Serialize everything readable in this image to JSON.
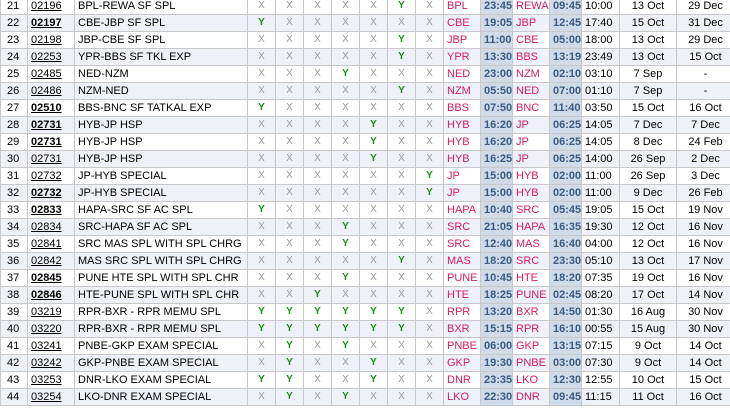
{
  "days_header": [
    "M",
    "T",
    "W",
    "T",
    "F",
    "S",
    "S"
  ],
  "rows": [
    {
      "sn": "21",
      "no": "02196",
      "bold": false,
      "name": "BPL-REWA SF SPL",
      "days": [
        "X",
        "X",
        "X",
        "X",
        "X",
        "Y",
        "X"
      ],
      "from": "BPL",
      "dep": "23:45",
      "to": "REWA",
      "arr": "09:45",
      "dur": "10:00",
      "start": "13 Oct",
      "end": "29 Dec"
    },
    {
      "sn": "22",
      "no": "02197",
      "bold": true,
      "name": "CBE-JBP SF SPL",
      "days": [
        "Y",
        "X",
        "X",
        "X",
        "X",
        "X",
        "X"
      ],
      "from": "CBE",
      "dep": "19:05",
      "to": "JBP",
      "arr": "12:45",
      "dur": "17:40",
      "start": "15 Oct",
      "end": "31 Dec"
    },
    {
      "sn": "23",
      "no": "02198",
      "bold": false,
      "name": "JBP-CBE SF SPL",
      "days": [
        "X",
        "X",
        "X",
        "X",
        "X",
        "Y",
        "X"
      ],
      "from": "JBP",
      "dep": "11:00",
      "to": "CBE",
      "arr": "05:00",
      "dur": "18:00",
      "start": "13 Oct",
      "end": "29 Dec"
    },
    {
      "sn": "24",
      "no": "02253",
      "bold": false,
      "name": "YPR-BBS SF TKL EXP",
      "days": [
        "X",
        "X",
        "X",
        "X",
        "X",
        "Y",
        "X"
      ],
      "from": "YPR",
      "dep": "13:30",
      "to": "BBS",
      "arr": "13:19",
      "dur": "23:49",
      "start": "13 Oct",
      "end": "15 Oct"
    },
    {
      "sn": "25",
      "no": "02485",
      "bold": false,
      "name": "NED-NZM",
      "days": [
        "X",
        "X",
        "X",
        "Y",
        "X",
        "X",
        "X"
      ],
      "from": "NED",
      "dep": "23:00",
      "to": "NZM",
      "arr": "02:10",
      "dur": "03:10",
      "start": "7 Sep",
      "end": "-"
    },
    {
      "sn": "26",
      "no": "02486",
      "bold": false,
      "name": "NZM-NED",
      "days": [
        "X",
        "X",
        "X",
        "X",
        "X",
        "Y",
        "X"
      ],
      "from": "NZM",
      "dep": "05:50",
      "to": "NED",
      "arr": "07:00",
      "dur": "01:10",
      "start": "7 Sep",
      "end": "-"
    },
    {
      "sn": "27",
      "no": "02510",
      "bold": true,
      "name": "BBS-BNC SF TATKAL EXP",
      "days": [
        "Y",
        "X",
        "X",
        "X",
        "X",
        "X",
        "X"
      ],
      "from": "BBS",
      "dep": "07:50",
      "to": "BNC",
      "arr": "11:40",
      "dur": "03:50",
      "start": "15 Oct",
      "end": "16 Oct"
    },
    {
      "sn": "28",
      "no": "02731",
      "bold": true,
      "name": "HYB-JP HSP",
      "days": [
        "X",
        "X",
        "X",
        "X",
        "Y",
        "X",
        "X"
      ],
      "from": "HYB",
      "dep": "16:20",
      "to": "JP",
      "arr": "06:25",
      "dur": "14:05",
      "start": "7 Dec",
      "end": "7 Dec"
    },
    {
      "sn": "29",
      "no": "02731",
      "bold": true,
      "name": "HYB-JP HSP",
      "days": [
        "X",
        "X",
        "X",
        "X",
        "Y",
        "X",
        "X"
      ],
      "from": "HYB",
      "dep": "16:20",
      "to": "JP",
      "arr": "06:25",
      "dur": "14:05",
      "start": "8 Dec",
      "end": "24 Feb"
    },
    {
      "sn": "30",
      "no": "02731",
      "bold": false,
      "name": "HYB-JP HSP",
      "days": [
        "X",
        "X",
        "X",
        "X",
        "Y",
        "X",
        "X"
      ],
      "from": "HYB",
      "dep": "16:25",
      "to": "JP",
      "arr": "06:25",
      "dur": "14:00",
      "start": "26 Sep",
      "end": "2 Dec"
    },
    {
      "sn": "31",
      "no": "02732",
      "bold": false,
      "name": "JP-HYB SPECIAL",
      "days": [
        "X",
        "X",
        "X",
        "X",
        "X",
        "X",
        "Y"
      ],
      "from": "JP",
      "dep": "15:00",
      "to": "HYB",
      "arr": "02:00",
      "dur": "11:00",
      "start": "26 Sep",
      "end": "3 Dec"
    },
    {
      "sn": "32",
      "no": "02732",
      "bold": true,
      "name": "JP-HYB SPECIAL",
      "days": [
        "X",
        "X",
        "X",
        "X",
        "X",
        "X",
        "Y"
      ],
      "from": "JP",
      "dep": "15:00",
      "to": "HYB",
      "arr": "02:00",
      "dur": "11:00",
      "start": "9 Dec",
      "end": "26 Feb"
    },
    {
      "sn": "33",
      "no": "02833",
      "bold": true,
      "name": "HAPA-SRC SF AC SPL",
      "days": [
        "Y",
        "X",
        "X",
        "X",
        "X",
        "X",
        "X"
      ],
      "from": "HAPA",
      "dep": "10:40",
      "to": "SRC",
      "arr": "05:45",
      "dur": "19:05",
      "start": "15 Oct",
      "end": "19 Nov"
    },
    {
      "sn": "34",
      "no": "02834",
      "bold": false,
      "name": "SRC-HAPA SF AC SPL",
      "days": [
        "X",
        "X",
        "X",
        "Y",
        "X",
        "X",
        "X"
      ],
      "from": "SRC",
      "dep": "21:05",
      "to": "HAPA",
      "arr": "16:35",
      "dur": "19:30",
      "start": "12 Oct",
      "end": "16 Nov"
    },
    {
      "sn": "35",
      "no": "02841",
      "bold": false,
      "name": "SRC MAS SPL WITH SPL CHRG",
      "days": [
        "X",
        "X",
        "X",
        "Y",
        "X",
        "X",
        "X"
      ],
      "from": "SRC",
      "dep": "12:40",
      "to": "MAS",
      "arr": "16:40",
      "dur": "04:00",
      "start": "12 Oct",
      "end": "16 Nov"
    },
    {
      "sn": "36",
      "no": "02842",
      "bold": false,
      "name": "MAS SRC SPL WITH SPL CHRG",
      "days": [
        "X",
        "X",
        "X",
        "X",
        "X",
        "Y",
        "X"
      ],
      "from": "MAS",
      "dep": "18:20",
      "to": "SRC",
      "arr": "23:30",
      "dur": "05:10",
      "start": "13 Oct",
      "end": "17 Nov"
    },
    {
      "sn": "37",
      "no": "02845",
      "bold": true,
      "name": "PUNE HTE SPL WITH SPL CHR",
      "days": [
        "X",
        "X",
        "X",
        "Y",
        "X",
        "X",
        "X"
      ],
      "from": "PUNE",
      "dep": "10:45",
      "to": "HTE",
      "arr": "18:20",
      "dur": "07:35",
      "start": "19 Oct",
      "end": "16 Nov"
    },
    {
      "sn": "38",
      "no": "02846",
      "bold": true,
      "name": "HTE-PUNE SPL WITH SPL CHR",
      "days": [
        "X",
        "X",
        "Y",
        "X",
        "X",
        "X",
        "X"
      ],
      "from": "HTE",
      "dep": "18:25",
      "to": "PUNE",
      "arr": "02:45",
      "dur": "08:20",
      "start": "17 Oct",
      "end": "14 Nov"
    },
    {
      "sn": "39",
      "no": "03219",
      "bold": false,
      "name": "RPR-BXR - RPR MEMU SPL",
      "days": [
        "Y",
        "Y",
        "Y",
        "Y",
        "Y",
        "Y",
        "X"
      ],
      "from": "RPR",
      "dep": "13:20",
      "to": "BXR",
      "arr": "14:50",
      "dur": "01:30",
      "start": "16 Aug",
      "end": "30 Nov"
    },
    {
      "sn": "40",
      "no": "03220",
      "bold": false,
      "name": "RPR-BXR - RPR MEMU SPL",
      "days": [
        "Y",
        "Y",
        "Y",
        "Y",
        "Y",
        "Y",
        "X"
      ],
      "from": "BXR",
      "dep": "15:15",
      "to": "RPR",
      "arr": "16:10",
      "dur": "00:55",
      "start": "15 Aug",
      "end": "30 Nov"
    },
    {
      "sn": "41",
      "no": "03241",
      "bold": false,
      "name": "PNBE-GKP EXAM SPECIAL",
      "days": [
        "X",
        "Y",
        "X",
        "Y",
        "X",
        "X",
        "X"
      ],
      "from": "PNBE",
      "dep": "06:00",
      "to": "GKP",
      "arr": "13:15",
      "dur": "07:15",
      "start": "9 Oct",
      "end": "14 Oct"
    },
    {
      "sn": "42",
      "no": "03242",
      "bold": false,
      "name": "GKP-PNBE EXAM SPECIAL",
      "days": [
        "X",
        "Y",
        "X",
        "X",
        "Y",
        "X",
        "X"
      ],
      "from": "GKP",
      "dep": "19:30",
      "to": "PNBE",
      "arr": "03:00",
      "dur": "07:30",
      "start": "9 Oct",
      "end": "14 Oct"
    },
    {
      "sn": "43",
      "no": "03253",
      "bold": false,
      "name": "DNR-LKO EXAM SPECIAL",
      "days": [
        "Y",
        "Y",
        "X",
        "X",
        "Y",
        "X",
        "X"
      ],
      "from": "DNR",
      "dep": "23:35",
      "to": "LKO",
      "arr": "12:30",
      "dur": "12:55",
      "start": "10 Oct",
      "end": "15 Oct"
    },
    {
      "sn": "44",
      "no": "03254",
      "bold": false,
      "name": "LKO-DNR EXAM SPECIAL",
      "days": [
        "X",
        "Y",
        "X",
        "Y",
        "X",
        "X",
        "X"
      ],
      "from": "LKO",
      "dep": "22:30",
      "to": "DNR",
      "arr": "09:45",
      "dur": "11:15",
      "start": "11 Oct",
      "end": "16 Oct"
    }
  ]
}
